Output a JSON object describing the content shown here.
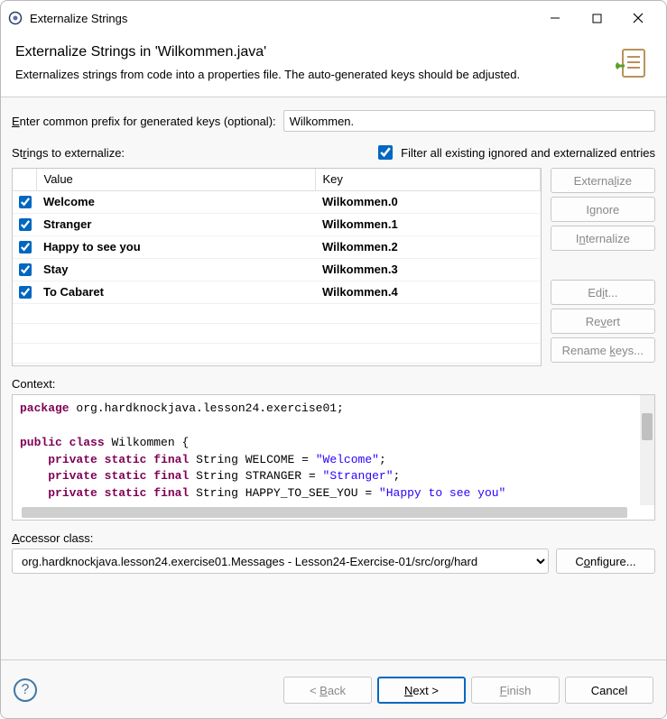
{
  "titlebar": {
    "title": "Externalize Strings"
  },
  "header": {
    "title": "Externalize Strings in 'Wilkommen.java'",
    "desc": "Externalizes strings from code into a properties file. The auto-generated keys should be adjusted."
  },
  "prefix": {
    "label_pre": "E",
    "label_post": "nter common prefix for generated keys (optional):",
    "value": "Wilkommen."
  },
  "strings_label_pre": "St",
  "strings_label_r": "r",
  "strings_label_post": "ings to externalize:",
  "filter": {
    "checked": true,
    "label": "Filter all existing ignored and externalized entries"
  },
  "table": {
    "col_value": "Value",
    "col_key": "Key",
    "rows": [
      {
        "checked": true,
        "value": "Welcome",
        "key": "Wilkommen.0"
      },
      {
        "checked": true,
        "value": "Stranger",
        "key": "Wilkommen.1"
      },
      {
        "checked": true,
        "value": "Happy to see you",
        "key": "Wilkommen.2"
      },
      {
        "checked": true,
        "value": "Stay",
        "key": "Wilkommen.3"
      },
      {
        "checked": true,
        "value": "To Cabaret",
        "key": "Wilkommen.4"
      }
    ]
  },
  "side": {
    "externalize": "Externalize",
    "ignore": "Ignore",
    "internalize": "Internalize",
    "edit": "Edit...",
    "revert": "Revert",
    "rename": "Rename keys..."
  },
  "context": {
    "label": "Context:"
  },
  "accessor": {
    "label": "Accessor class:",
    "value": "org.hardknockjava.lesson24.exercise01.Messages - Lesson24-Exercise-01/src/org/hard",
    "configure": "Configure..."
  },
  "footer": {
    "back": "< Back",
    "next": "Next >",
    "finish": "Finish",
    "cancel": "Cancel"
  }
}
